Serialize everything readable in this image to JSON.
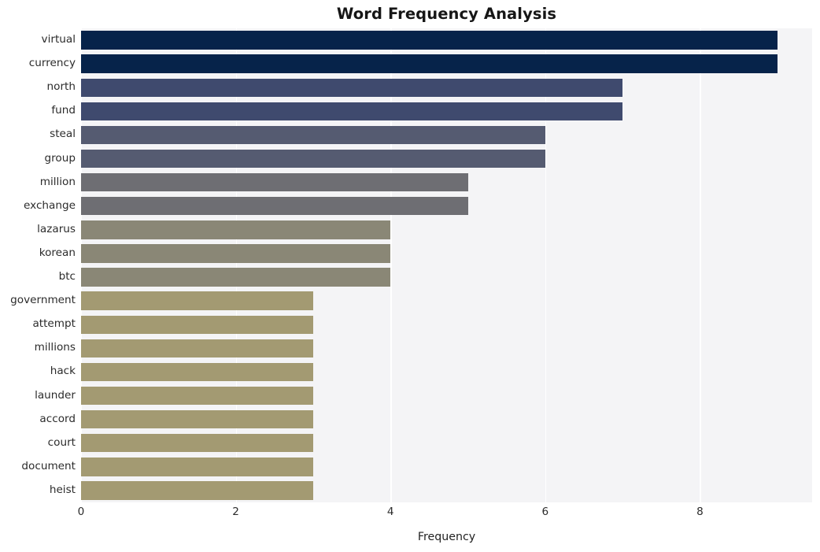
{
  "chart_data": {
    "type": "bar",
    "orientation": "horizontal",
    "title": "Word Frequency Analysis",
    "xlabel": "Frequency",
    "ylabel": "",
    "xlim": [
      0,
      9.45
    ],
    "ylim_categories": 20,
    "grid": true,
    "grid_axis": "x",
    "legend": null,
    "xticks": [
      0,
      2,
      4,
      6,
      8
    ],
    "xticklabels": [
      "0",
      "2",
      "4",
      "6",
      "8"
    ],
    "categories": [
      "virtual",
      "currency",
      "north",
      "fund",
      "steal",
      "group",
      "million",
      "exchange",
      "lazarus",
      "korean",
      "btc",
      "government",
      "attempt",
      "millions",
      "hack",
      "launder",
      "accord",
      "court",
      "document",
      "heist"
    ],
    "values": [
      9,
      9,
      7,
      7,
      6,
      6,
      5,
      5,
      4,
      4,
      4,
      3,
      3,
      3,
      3,
      3,
      3,
      3,
      3,
      3
    ],
    "bar_colors": [
      "#06234a",
      "#06234a",
      "#3f4a6e",
      "#3f4a6e",
      "#555b71",
      "#555b71",
      "#6e6e73",
      "#6e6e73",
      "#8a8776",
      "#8a8776",
      "#8a8776",
      "#a39a72",
      "#a39a72",
      "#a39a72",
      "#a39a72",
      "#a39a72",
      "#a39a72",
      "#a39a72",
      "#a39a72",
      "#a39a72"
    ],
    "plot_background": "#f4f4f6",
    "figure_background": "#ffffff",
    "gridline_color": "#ffffff",
    "text_color": "#2b2b2b"
  }
}
